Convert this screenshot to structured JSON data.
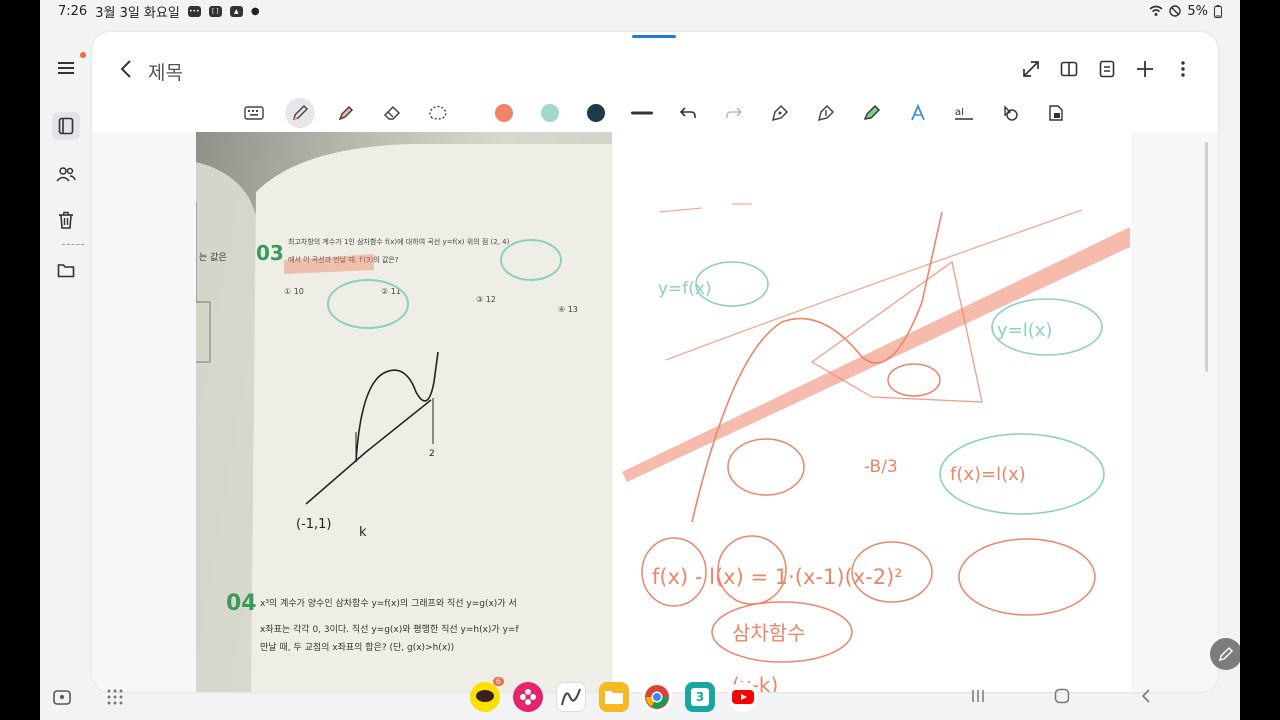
{
  "status_bar": {
    "time": "7:26",
    "date": "3월 3일 화요일",
    "battery": "5%"
  },
  "note": {
    "title": "제목"
  },
  "toolbar": {
    "pen_colors": [
      "#ef8468",
      "#a3d7c9",
      "#1e3a46"
    ]
  },
  "photo_text": {
    "problem_03_number": "03",
    "problem_03_line1": "최고차항의 계수가 1인 삼차함수 f(x)에 대하여 곡선 y=f(x) 위의 점 (2, 4)",
    "problem_03_line2": "에서 이 곡선과 만날 때, f′(3)의 값은?",
    "choice_1": "① 10",
    "choice_2": "② 11",
    "choice_3": "③ 12",
    "choice_4": "④ 13",
    "side_text": "는 값은",
    "graph_label_left": "(-1,1)",
    "graph_label_k": "k",
    "graph_label_2": "2",
    "problem_04_number": "04",
    "problem_04_line1": "x³의 계수가 양수인 삼차함수 y=f(x)의 그래프와 직선 y=g(x)가 서",
    "problem_04_line2": "x좌표는 각각 0, 3이다. 직선 y=g(x)와 평행한 직선 y=h(x)가 y=f",
    "problem_04_line3": "만날 때, 두 교점의 x좌표의 합은? (단, g(x)>h(x))"
  },
  "handwriting": {
    "y_fx": "y=f(x)",
    "y_lx": "y=l(x)",
    "fx_eq_lx": "f(x)=l(x)",
    "neg_b_3": "-B/3",
    "f_minus_l": "f(x) - l(x) = 1·(x-1)(x-2)²",
    "cubic": "삼차함수",
    "xk": "(x-k)"
  },
  "dock": {
    "kakao_badge": "6",
    "calendar_day": "3"
  }
}
